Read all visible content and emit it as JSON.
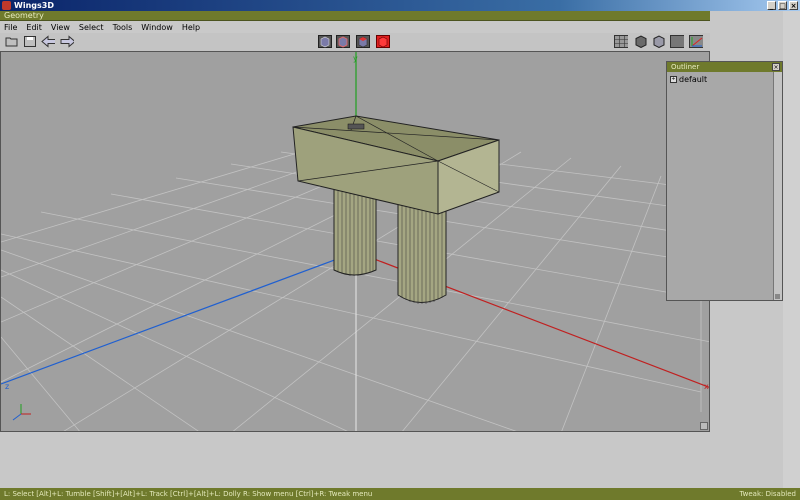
{
  "window": {
    "title": "Wings3D"
  },
  "geometry": {
    "header": "Geometry"
  },
  "menu": [
    "File",
    "Edit",
    "View",
    "Select",
    "Tools",
    "Window",
    "Help"
  ],
  "toolbar": {
    "left_icons": [
      "open-icon",
      "save-icon",
      "undo-arrow-icon",
      "redo-arrow-icon"
    ],
    "select_modes": [
      "vertex-mode-icon",
      "edge-mode-icon",
      "face-mode-icon",
      "body-mode-icon"
    ],
    "right_icons": [
      "grid-icon",
      "wireframe-icon",
      "shaded-icon",
      "texture-icon",
      "axes-icon"
    ]
  },
  "viewport": {
    "axis_labels": {
      "x": "x",
      "y": "y",
      "z": "z"
    }
  },
  "outliner": {
    "title": "Outliner",
    "items": [
      "default"
    ]
  },
  "status": {
    "hints": "L: Select   [Alt]+L: Tumble   [Shift]+[Alt]+L: Track   [Ctrl]+[Alt]+L: Dolly   R: Show menu   [Ctrl]+R: Tweak menu",
    "tweak": "Tweak: Disabled"
  },
  "colors": {
    "accent": "#6f7a2c",
    "x_axis": "#c02020",
    "y_axis": "#20a020",
    "z_axis": "#2060d0",
    "model": "#9ea17c"
  }
}
